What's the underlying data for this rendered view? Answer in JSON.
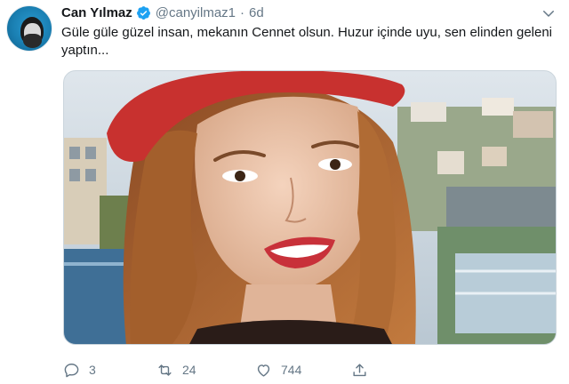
{
  "tweet": {
    "author_name": "Can Yılmaz",
    "handle": "@canyilmaz1",
    "separator": "·",
    "time": "6d",
    "text": "Güle güle güzel insan, mekanın Cennet olsun. Huzur içinde uyu, sen elinden geleni yaptın...",
    "verified": true
  },
  "actions": {
    "reply_count": "3",
    "retweet_count": "24",
    "like_count": "744"
  },
  "icons": {
    "verified": "verified-badge-icon",
    "chevron": "chevron-down-icon",
    "reply": "reply-icon",
    "retweet": "retweet-icon",
    "like": "heart-icon",
    "share": "share-icon"
  },
  "colors": {
    "text": "#14171a",
    "secondary": "#657786",
    "accent": "#1da1f2"
  }
}
